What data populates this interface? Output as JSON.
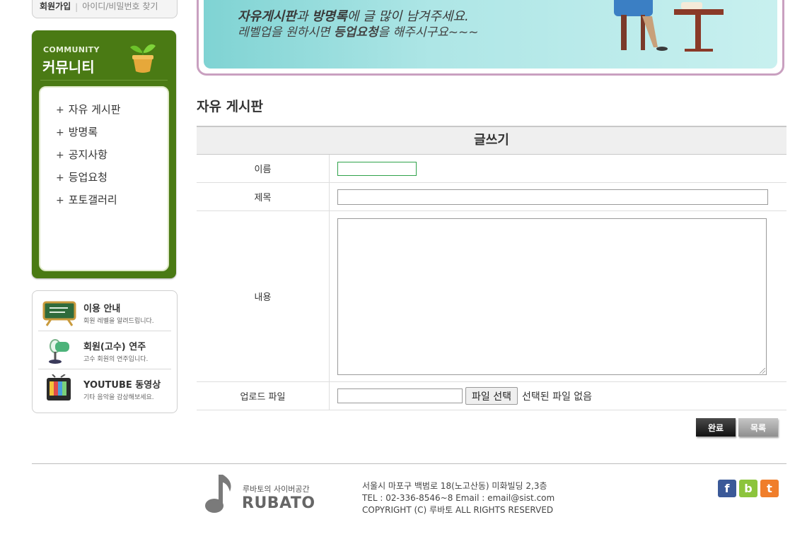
{
  "login": {
    "join": "회원가입",
    "sep": "|",
    "find": "아이디/비밀번호 찾기"
  },
  "community": {
    "title_en": "COMMUNITY",
    "title_ko": "커뮤니티",
    "items": [
      {
        "label": "자유 게시판"
      },
      {
        "label": "방명록"
      },
      {
        "label": "공지사항"
      },
      {
        "label": "등업요청"
      },
      {
        "label": "포토갤러리"
      }
    ]
  },
  "guide": {
    "items": [
      {
        "title": "이용 안내",
        "sub": "회원 레벨을 알려드립니다.",
        "icon": "board-icon"
      },
      {
        "title": "회원(고수) 연주",
        "sub": "고수 회원의 연주입니다.",
        "icon": "microphone-icon"
      },
      {
        "title": "YOUTUBE 동영상",
        "sub": "기타 음악을 감상해보세요.",
        "icon": "tv-icon"
      }
    ]
  },
  "banner": {
    "line1_bold1": "자유게시판",
    "line1_mid": "과 ",
    "line1_bold2": "방명록",
    "line1_rest": "에 글 많이 남겨주세요.",
    "line2_pre": "레벨업을 원하시면 ",
    "line2_bold": "등업요청",
    "line2_post": "을 해주시구요~~~"
  },
  "board": {
    "title": "자유 게시판",
    "form_heading": "글쓰기",
    "labels": {
      "name": "이름",
      "subject": "제목",
      "content": "내용",
      "upload": "업로드 파일"
    },
    "values": {
      "name": "",
      "subject": "",
      "content": ""
    },
    "file_button": "파일 선택",
    "file_status": "선택된 파일 없음",
    "submit": "완료",
    "list": "목록"
  },
  "footer": {
    "slogan": "루바토의 사이버공간",
    "brand": "RUBATO",
    "address": "서울시 마포구 백범로 18(노고산동) 미화빌딩 2,3층",
    "contact": "TEL : 02-336-8546~8 Email : email@sist.com",
    "copyright": "COPYRIGHT (C) 루바토 ALL RIGHTS RESERVED",
    "sns": [
      {
        "label": "f",
        "icon": "facebook-icon"
      },
      {
        "label": "b",
        "icon": "blog-icon"
      },
      {
        "label": "t",
        "icon": "twitter-icon"
      }
    ]
  },
  "colors": {
    "community_bg": "#4a7a14",
    "banner_border": "#c9a0c0",
    "banner_bg": "#aee6e6"
  }
}
